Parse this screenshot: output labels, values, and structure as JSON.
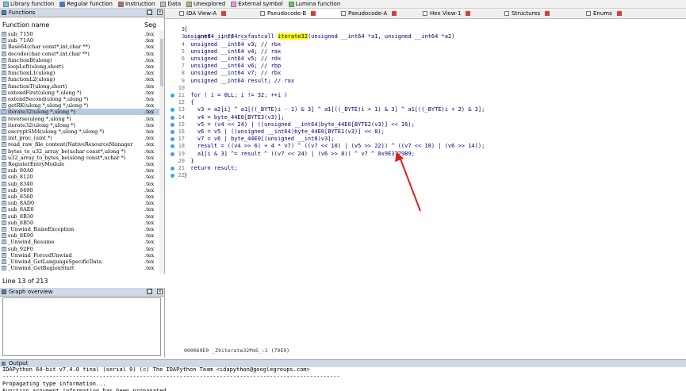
{
  "legend": [
    {
      "label": "Library function",
      "color": "#6fc3e8"
    },
    {
      "label": "Regular function",
      "color": "#3a7dd8"
    },
    {
      "label": "Instruction",
      "color": "#b07060"
    },
    {
      "label": "Data",
      "color": "#c0c0c0"
    },
    {
      "label": "Unexplored",
      "color": "#b5b57a"
    },
    {
      "label": "External symbol",
      "color": "#f29ad8"
    },
    {
      "label": "Lumina function",
      "color": "#52d16e"
    }
  ],
  "functions_panel": {
    "title": "Functions",
    "col_name": "Function name",
    "col_seg": "Seg",
    "items": [
      {
        "name": "sub_7150",
        "seg": ".tex"
      },
      {
        "name": "sub_71A0",
        "seg": ".tex"
      },
      {
        "name": "Base64(char const*,int,char **)",
        "seg": ".tex"
      },
      {
        "name": "decode(char const*,int,char **)",
        "seg": ".tex"
      },
      {
        "name": "functionB(ulong)",
        "seg": ".tex"
      },
      {
        "name": "loopLeft(ulong,short)",
        "seg": ".tex"
      },
      {
        "name": "functionL1(ulong)",
        "seg": ".tex"
      },
      {
        "name": "functionL2(ulong)",
        "seg": ".tex"
      },
      {
        "name": "functionT(ulong,short)",
        "seg": ".tex"
      },
      {
        "name": "extendFirst(ulong *,ulong *)",
        "seg": ".tex"
      },
      {
        "name": "extendSecond(ulong *,ulong *)",
        "seg": ".tex"
      },
      {
        "name": "getRK(ulong *,ulong *,ulong *)",
        "seg": ".tex"
      },
      {
        "name": "iterate32(ulong *,ulong *)",
        "seg": ".tex"
      },
      {
        "name": "reverse(ulong *,ulong *)",
        "seg": ".tex"
      },
      {
        "name": "iterate32(ulong *,ulong *)",
        "seg": ".tex"
      },
      {
        "name": "encryptSM4(ulong *,ulong *,ulong *)",
        "seg": ".tex"
      },
      {
        "name": "init_proc_(uint *)",
        "seg": ".tex"
      },
      {
        "name": "read_raw_file_content(NativeResourceManager ...",
        "seg": ".tex"
      },
      {
        "name": "bytes_to_u32_array_be(uchar const*,ulong *)",
        "seg": ".tex"
      },
      {
        "name": "u32_array_to_bytes_be(ulong const*,uchar *)",
        "seg": ".tex"
      },
      {
        "name": "RegisterEntryModule",
        "seg": ".tex"
      },
      {
        "name": "sub_80A0",
        "seg": ".tex"
      },
      {
        "name": "sub_8120",
        "seg": ".tex"
      },
      {
        "name": "sub_8340",
        "seg": ".tex"
      },
      {
        "name": "sub_8490",
        "seg": ".tex"
      },
      {
        "name": "sub_8560",
        "seg": ".tex"
      },
      {
        "name": "sub_8AD0",
        "seg": ".tex"
      },
      {
        "name": "sub_8AE0",
        "seg": ".tex"
      },
      {
        "name": "sub_8B30",
        "seg": ".tex"
      },
      {
        "name": "sub_8B50",
        "seg": ".tex"
      },
      {
        "name": "_Unwind_RaiseException",
        "seg": ".tex"
      },
      {
        "name": "sub_8E90",
        "seg": ".tex"
      },
      {
        "name": "_Unwind_Resume",
        "seg": ".tex"
      },
      {
        "name": "sub_92F0",
        "seg": ".tex"
      },
      {
        "name": "_Unwind_ForcedUnwind",
        "seg": ".tex"
      },
      {
        "name": "_Unwind_GetLanguageSpecificData",
        "seg": ".tex"
      },
      {
        "name": "_Unwind_GetRegionStart",
        "seg": ".tex"
      }
    ],
    "selected_index": 12,
    "status": "Line 13 of 213"
  },
  "graph_panel": {
    "title": "Graph overview"
  },
  "tabs": [
    {
      "label": "IDA View-A",
      "active": false
    },
    {
      "label": "Pseudocode-B",
      "active": true
    },
    {
      "label": "Pseudocode-A",
      "active": false
    },
    {
      "label": "Hex View-1",
      "active": false
    },
    {
      "label": "Structures",
      "active": false
    },
    {
      "label": "Enums",
      "active": false
    }
  ],
  "code": {
    "header_pre": "unsigned __int64 __fastcall ",
    "header_fn": "iterate32",
    "header_post": "(unsigned __int64 *a1, unsigned __int64 *a2)",
    "lines": [
      {
        "n": "2",
        "text": "{",
        "dot": false
      },
      {
        "n": "3",
        "text": "  __int64 i; // rcx",
        "dot": false
      },
      {
        "n": "4",
        "text": "  unsigned __int64 v3; // rbx",
        "dot": false
      },
      {
        "n": "5",
        "text": "  unsigned __int64 v4; // rax",
        "dot": false
      },
      {
        "n": "6",
        "text": "  unsigned __int64 v5; // rdx",
        "dot": false
      },
      {
        "n": "7",
        "text": "  unsigned __int64 v6; // rbp",
        "dot": false
      },
      {
        "n": "8",
        "text": "  unsigned __int64 v7; // rbx",
        "dot": false
      },
      {
        "n": "9",
        "text": "  unsigned __int64 result; // rax",
        "dot": false
      },
      {
        "n": "10",
        "text": "",
        "dot": false
      },
      {
        "n": "11",
        "text": "  for ( i = 0LL; i != 32; ++i )",
        "dot": true
      },
      {
        "n": "12",
        "text": "  {",
        "dot": false
      },
      {
        "n": "13",
        "text": "    v3 = a2[i] ^ a1[((_BYTE)i - 1) & 3] ^ a1[((_BYTE)i + 1) & 3] ^ a1[((_BYTE)i + 2) & 3];",
        "dot": true
      },
      {
        "n": "14",
        "text": "    v4 = byte_44E0[BYTE3(v3)];",
        "dot": true
      },
      {
        "n": "15",
        "text": "    v5 = (v4 << 24) | ((unsigned __int64)byte_44E0[BYTE2(v3)] << 16);",
        "dot": true
      },
      {
        "n": "16",
        "text": "    v6 = v5 | ((unsigned __int64)byte_44E0[BYTE1(v3)] << 8);",
        "dot": true
      },
      {
        "n": "17",
        "text": "    v7 = v6 | byte_44E0[(unsigned __int8)v3];",
        "dot": true
      },
      {
        "n": "18",
        "text": "    result = ((v4 >> 6) + 4 * v7) ^ ((v7 << 10) | (v5 >> 22)) ^ ((v7 << 18) | (v6 >> 14));",
        "dot": true
      },
      {
        "n": "19",
        "text": "    a1[i & 3] ^= result ^ ((v7 << 24) | (v6 >> 8)) ^ v7 ^ 0x9E3779B9;",
        "dot": true
      },
      {
        "n": "20",
        "text": "  }",
        "dot": false
      },
      {
        "n": "21",
        "text": "  return result;",
        "dot": true
      },
      {
        "n": "22",
        "text": "}",
        "dot": true
      }
    ],
    "status": "000069E0 _Z9iterate32PmS_:1 (79E0)"
  },
  "output": {
    "title": "Output",
    "lines": [
      "IDAPython 64-bit v7.4.0 final (serial 0) (c) The IDAPython Team <idapython@googlegroups.com>",
      "-----------------------------------------------------------------------------------------------------",
      "Propagating type information...",
      "Function argument information has been propagated"
    ]
  }
}
